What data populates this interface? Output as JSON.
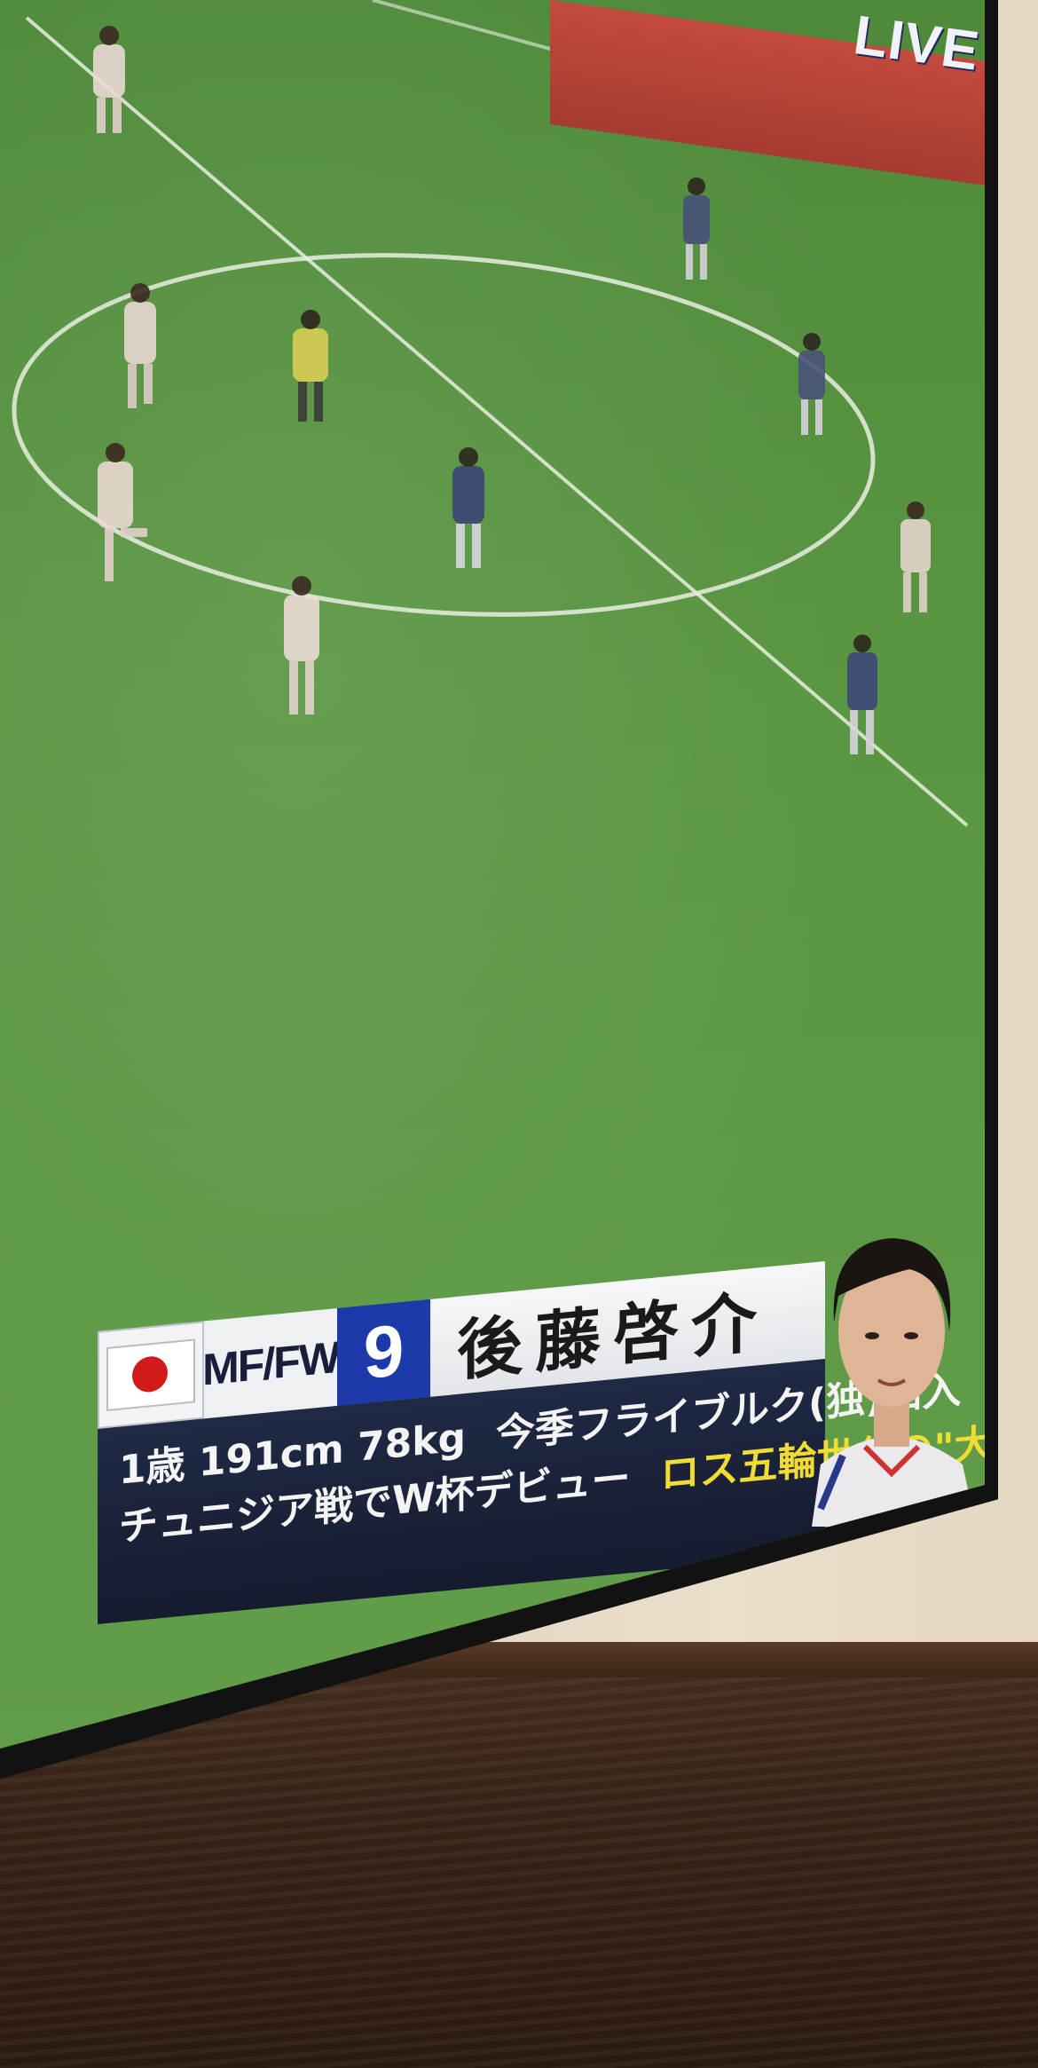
{
  "broadcast": {
    "live_label": "LIVE"
  },
  "lower_third": {
    "flag": "japan-flag",
    "position": "MF/FW",
    "number": "9",
    "name": "後藤啓介",
    "line1_left": "1歳 191cm 78kg",
    "line1_right": "今季フライブルク(独)加入",
    "line2_left": "チュニジア戦でW杯デビュー",
    "line2_right": "ロス五輪世代の\"大器\""
  },
  "colors": {
    "pitch": "#5e9a47",
    "name_plate": "#f3f3f5",
    "number_plate": "#1c3aa8",
    "info_plate": "#1a2238",
    "highlight_text": "#f0dc35",
    "live_banner": "#b8443a"
  }
}
